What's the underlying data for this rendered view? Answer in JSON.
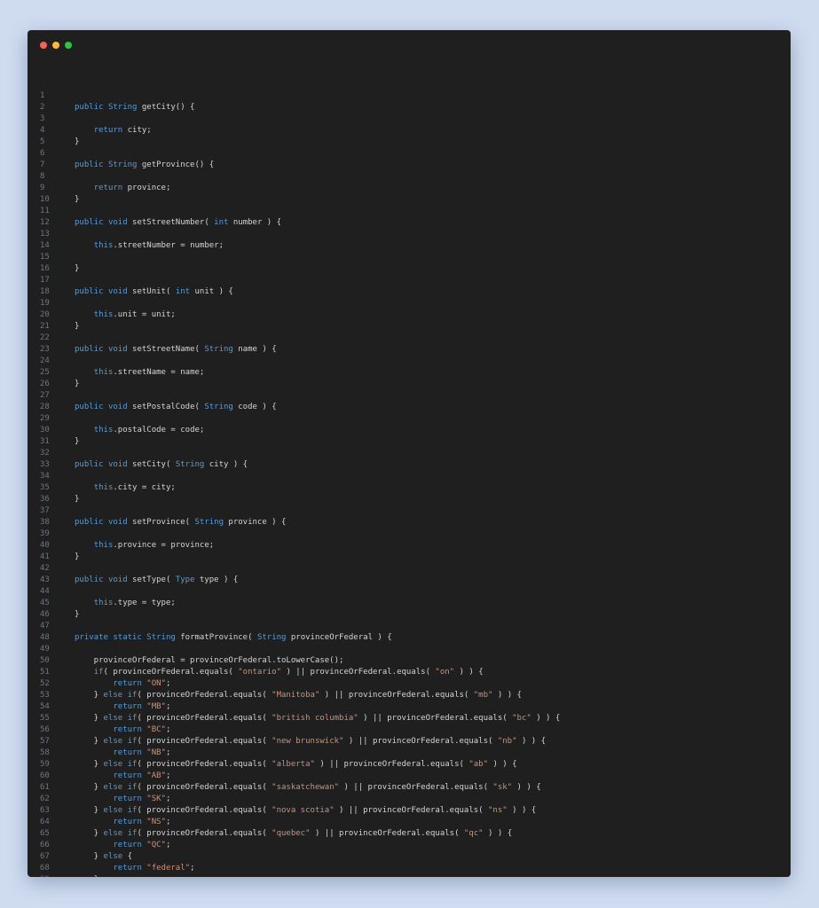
{
  "window": {
    "controls": {
      "close_color": "#ff5f57",
      "minimize_color": "#febc2e",
      "zoom_color": "#28c840"
    }
  },
  "editor": {
    "theme": {
      "background": "#1f1f1f",
      "text": "#d4d4d4",
      "keyword": "#569cd6",
      "string": "#ce9178",
      "line_number": "#6e7681"
    },
    "lines": [
      [],
      [
        {
          "t": "public ",
          "k": "kw"
        },
        {
          "t": "String",
          "k": "kw"
        },
        {
          "t": " getCity() {"
        }
      ],
      [],
      [
        {
          "t": "    "
        },
        {
          "t": "return",
          "k": "kw"
        },
        {
          "t": " city;"
        }
      ],
      [
        {
          "t": "}"
        }
      ],
      [],
      [
        {
          "t": "public ",
          "k": "kw"
        },
        {
          "t": "String",
          "k": "kw"
        },
        {
          "t": " getProvince() {"
        }
      ],
      [],
      [
        {
          "t": "    "
        },
        {
          "t": "return",
          "k": "kw"
        },
        {
          "t": " province;"
        }
      ],
      [
        {
          "t": "}"
        }
      ],
      [],
      [
        {
          "t": "public ",
          "k": "kw"
        },
        {
          "t": "void",
          "k": "kw"
        },
        {
          "t": " setStreetNumber( "
        },
        {
          "t": "int",
          "k": "kw"
        },
        {
          "t": " number ) {"
        }
      ],
      [],
      [
        {
          "t": "    "
        },
        {
          "t": "this",
          "k": "kw"
        },
        {
          "t": ".streetNumber = number;"
        }
      ],
      [],
      [
        {
          "t": "}"
        }
      ],
      [],
      [
        {
          "t": "public ",
          "k": "kw"
        },
        {
          "t": "void",
          "k": "kw"
        },
        {
          "t": " setUnit( "
        },
        {
          "t": "int",
          "k": "kw"
        },
        {
          "t": " unit ) {"
        }
      ],
      [],
      [
        {
          "t": "    "
        },
        {
          "t": "this",
          "k": "kw"
        },
        {
          "t": ".unit = unit;"
        }
      ],
      [
        {
          "t": "}"
        }
      ],
      [],
      [
        {
          "t": "public ",
          "k": "kw"
        },
        {
          "t": "void",
          "k": "kw"
        },
        {
          "t": " setStreetName( "
        },
        {
          "t": "String",
          "k": "kw"
        },
        {
          "t": " name ) {"
        }
      ],
      [],
      [
        {
          "t": "    "
        },
        {
          "t": "this",
          "k": "kw"
        },
        {
          "t": ".streetName = name;"
        }
      ],
      [
        {
          "t": "}"
        }
      ],
      [],
      [
        {
          "t": "public ",
          "k": "kw"
        },
        {
          "t": "void",
          "k": "kw"
        },
        {
          "t": " setPostalCode( "
        },
        {
          "t": "String",
          "k": "kw"
        },
        {
          "t": " code ) {"
        }
      ],
      [],
      [
        {
          "t": "    "
        },
        {
          "t": "this",
          "k": "kw"
        },
        {
          "t": ".postalCode = code;"
        }
      ],
      [
        {
          "t": "}"
        }
      ],
      [],
      [
        {
          "t": "public ",
          "k": "kw"
        },
        {
          "t": "void",
          "k": "kw"
        },
        {
          "t": " setCity( "
        },
        {
          "t": "String",
          "k": "kw"
        },
        {
          "t": " city ) {"
        }
      ],
      [],
      [
        {
          "t": "    "
        },
        {
          "t": "this",
          "k": "kw"
        },
        {
          "t": ".city = city;"
        }
      ],
      [
        {
          "t": "}"
        }
      ],
      [],
      [
        {
          "t": "public ",
          "k": "kw"
        },
        {
          "t": "void",
          "k": "kw"
        },
        {
          "t": " setProvince( "
        },
        {
          "t": "String",
          "k": "kw"
        },
        {
          "t": " province ) {"
        }
      ],
      [],
      [
        {
          "t": "    "
        },
        {
          "t": "this",
          "k": "kw"
        },
        {
          "t": ".province = province;"
        }
      ],
      [
        {
          "t": "}"
        }
      ],
      [],
      [
        {
          "t": "public ",
          "k": "kw"
        },
        {
          "t": "void",
          "k": "kw"
        },
        {
          "t": " setType( "
        },
        {
          "t": "Type",
          "k": "kw"
        },
        {
          "t": " type ) {"
        }
      ],
      [],
      [
        {
          "t": "    "
        },
        {
          "t": "this",
          "k": "kw"
        },
        {
          "t": ".type = type;"
        }
      ],
      [
        {
          "t": "}"
        }
      ],
      [],
      [
        {
          "t": "private ",
          "k": "kw"
        },
        {
          "t": "static ",
          "k": "kw"
        },
        {
          "t": "String",
          "k": "kw"
        },
        {
          "t": " formatProvince( "
        },
        {
          "t": "String",
          "k": "kw"
        },
        {
          "t": " provinceOrFederal ) {"
        }
      ],
      [],
      [
        {
          "t": "    provinceOrFederal = provinceOrFederal.toLowerCase();"
        }
      ],
      [
        {
          "t": "    "
        },
        {
          "t": "if",
          "k": "kw"
        },
        {
          "t": "( provinceOrFederal.equals( "
        },
        {
          "t": "\"ontario\"",
          "k": "str"
        },
        {
          "t": " ) || provinceOrFederal.equals( "
        },
        {
          "t": "\"on\"",
          "k": "str"
        },
        {
          "t": " ) ) {"
        }
      ],
      [
        {
          "t": "        "
        },
        {
          "t": "return",
          "k": "kw"
        },
        {
          "t": " "
        },
        {
          "t": "\"ON\"",
          "k": "str"
        },
        {
          "t": ";"
        }
      ],
      [
        {
          "t": "    } "
        },
        {
          "t": "else if",
          "k": "kw"
        },
        {
          "t": "( provinceOrFederal.equals( "
        },
        {
          "t": "\"Manitoba\"",
          "k": "str"
        },
        {
          "t": " ) || provinceOrFederal.equals( "
        },
        {
          "t": "\"mb\"",
          "k": "str"
        },
        {
          "t": " ) ) {"
        }
      ],
      [
        {
          "t": "        "
        },
        {
          "t": "return",
          "k": "kw"
        },
        {
          "t": " "
        },
        {
          "t": "\"MB\"",
          "k": "str"
        },
        {
          "t": ";"
        }
      ],
      [
        {
          "t": "    } "
        },
        {
          "t": "else if",
          "k": "kw"
        },
        {
          "t": "( provinceOrFederal.equals( "
        },
        {
          "t": "\"british columbia\"",
          "k": "str"
        },
        {
          "t": " ) || provinceOrFederal.equals( "
        },
        {
          "t": "\"bc\"",
          "k": "str"
        },
        {
          "t": " ) ) {"
        }
      ],
      [
        {
          "t": "        "
        },
        {
          "t": "return",
          "k": "kw"
        },
        {
          "t": " "
        },
        {
          "t": "\"BC\"",
          "k": "str"
        },
        {
          "t": ";"
        }
      ],
      [
        {
          "t": "    } "
        },
        {
          "t": "else if",
          "k": "kw"
        },
        {
          "t": "( provinceOrFederal.equals( "
        },
        {
          "t": "\"new brunswick\"",
          "k": "str"
        },
        {
          "t": " ) || provinceOrFederal.equals( "
        },
        {
          "t": "\"nb\"",
          "k": "str"
        },
        {
          "t": " ) ) {"
        }
      ],
      [
        {
          "t": "        "
        },
        {
          "t": "return",
          "k": "kw"
        },
        {
          "t": " "
        },
        {
          "t": "\"NB\"",
          "k": "str"
        },
        {
          "t": ";"
        }
      ],
      [
        {
          "t": "    } "
        },
        {
          "t": "else if",
          "k": "kw"
        },
        {
          "t": "( provinceOrFederal.equals( "
        },
        {
          "t": "\"alberta\"",
          "k": "str"
        },
        {
          "t": " ) || provinceOrFederal.equals( "
        },
        {
          "t": "\"ab\"",
          "k": "str"
        },
        {
          "t": " ) ) {"
        }
      ],
      [
        {
          "t": "        "
        },
        {
          "t": "return",
          "k": "kw"
        },
        {
          "t": " "
        },
        {
          "t": "\"AB\"",
          "k": "str"
        },
        {
          "t": ";"
        }
      ],
      [
        {
          "t": "    } "
        },
        {
          "t": "else if",
          "k": "kw"
        },
        {
          "t": "( provinceOrFederal.equals( "
        },
        {
          "t": "\"saskatchewan\"",
          "k": "str"
        },
        {
          "t": " ) || provinceOrFederal.equals( "
        },
        {
          "t": "\"sk\"",
          "k": "str"
        },
        {
          "t": " ) ) {"
        }
      ],
      [
        {
          "t": "        "
        },
        {
          "t": "return",
          "k": "kw"
        },
        {
          "t": " "
        },
        {
          "t": "\"SK\"",
          "k": "str"
        },
        {
          "t": ";"
        }
      ],
      [
        {
          "t": "    } "
        },
        {
          "t": "else if",
          "k": "kw"
        },
        {
          "t": "( provinceOrFederal.equals( "
        },
        {
          "t": "\"nova scotia\"",
          "k": "str"
        },
        {
          "t": " ) || provinceOrFederal.equals( "
        },
        {
          "t": "\"ns\"",
          "k": "str"
        },
        {
          "t": " ) ) {"
        }
      ],
      [
        {
          "t": "        "
        },
        {
          "t": "return",
          "k": "kw"
        },
        {
          "t": " "
        },
        {
          "t": "\"NS\"",
          "k": "str"
        },
        {
          "t": ";"
        }
      ],
      [
        {
          "t": "    } "
        },
        {
          "t": "else if",
          "k": "kw"
        },
        {
          "t": "( provinceOrFederal.equals( "
        },
        {
          "t": "\"quebec\"",
          "k": "str"
        },
        {
          "t": " ) || provinceOrFederal.equals( "
        },
        {
          "t": "\"qc\"",
          "k": "str"
        },
        {
          "t": " ) ) {"
        }
      ],
      [
        {
          "t": "        "
        },
        {
          "t": "return",
          "k": "kw"
        },
        {
          "t": " "
        },
        {
          "t": "\"QC\"",
          "k": "str"
        },
        {
          "t": ";"
        }
      ],
      [
        {
          "t": "    } "
        },
        {
          "t": "else",
          "k": "kw"
        },
        {
          "t": " {"
        }
      ],
      [
        {
          "t": "        "
        },
        {
          "t": "return",
          "k": "kw"
        },
        {
          "t": " "
        },
        {
          "t": "\"federal\"",
          "k": "str"
        },
        {
          "t": ";"
        }
      ],
      [
        {
          "t": "    }"
        }
      ],
      [
        {
          "t": "}"
        }
      ]
    ]
  }
}
